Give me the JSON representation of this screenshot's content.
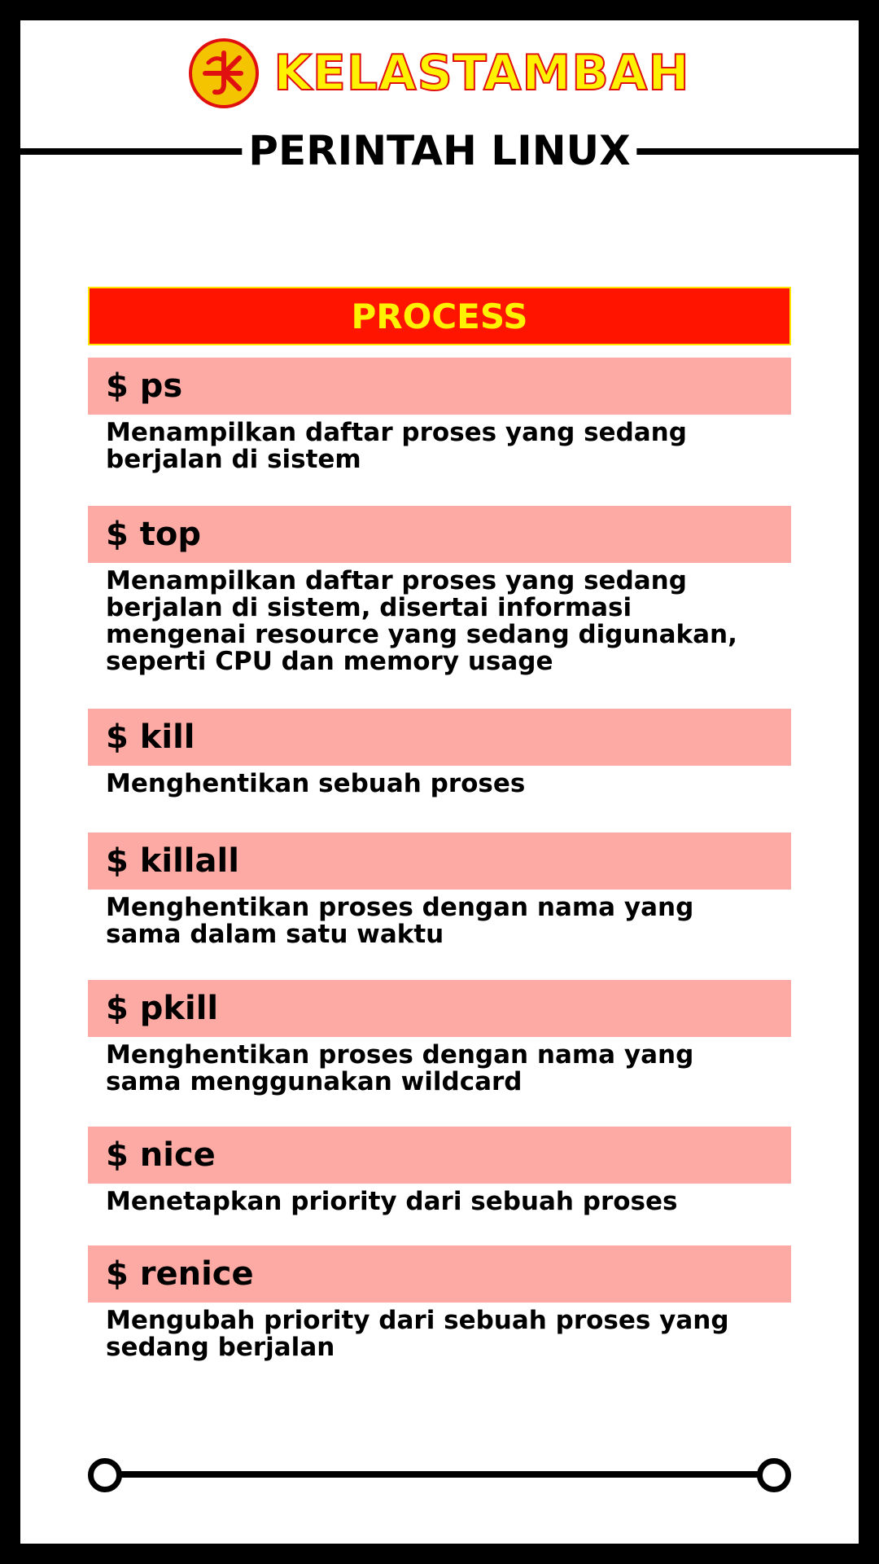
{
  "brand": {
    "name": "KELASTAMBAH",
    "logo_icon": "kelastambah-logo-icon",
    "logo_color": "#f5c400",
    "text_color": "#fff200",
    "outline_color": "#e01010"
  },
  "page": {
    "title": "PERINTAH LINUX"
  },
  "section": {
    "title": "PROCESS",
    "header_bg": "#ff1400",
    "header_text": "#fff200",
    "bar_bg": "#fcaaa3"
  },
  "commands": [
    {
      "name": "$ ps",
      "description": "Menampilkan daftar proses yang sedang berjalan di sistem"
    },
    {
      "name": "$ top",
      "description": "Menampilkan daftar proses yang sedang berjalan di sistem, disertai informasi mengenai resource yang sedang digunakan, seperti CPU dan memory usage"
    },
    {
      "name": "$ kill",
      "description": "Menghentikan sebuah proses"
    },
    {
      "name": "$ killall",
      "description": "Menghentikan proses dengan nama yang sama dalam satu waktu"
    },
    {
      "name": "$ pkill",
      "description": "Menghentikan proses dengan nama yang sama menggunakan wildcard"
    },
    {
      "name": "$ nice",
      "description": "Menetapkan priority dari sebuah proses"
    },
    {
      "name": "$ renice",
      "description": "Mengubah priority dari sebuah proses yang sedang berjalan"
    }
  ]
}
